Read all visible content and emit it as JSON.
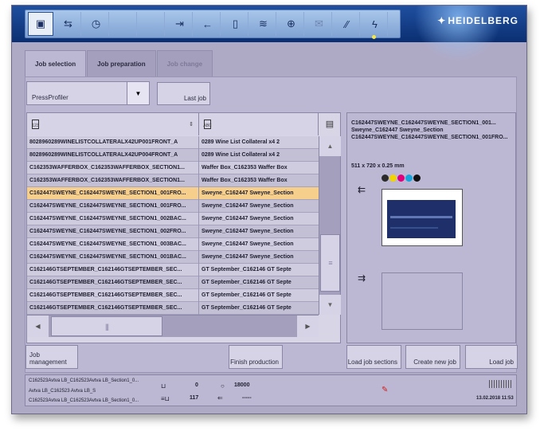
{
  "brand": "HEIDELBERG",
  "toolbar": {
    "buttons": [
      {
        "icon": "job-screen-icon",
        "active": true
      },
      {
        "icon": "transfer-icon"
      },
      {
        "icon": "clock-doc-icon"
      },
      {
        "icon": "blank-icon"
      },
      {
        "icon": "blank-icon"
      },
      {
        "icon": "feeder-icon"
      },
      {
        "icon": "arrow-left-icon"
      },
      {
        "icon": "plate-icon"
      },
      {
        "icon": "ink-fountain-icon"
      },
      {
        "icon": "register-icon"
      },
      {
        "icon": "mail-icon",
        "dim": true
      },
      {
        "icon": "pressure-icon"
      },
      {
        "icon": "lightning-icon"
      }
    ],
    "indicator_color": "#f4e64b"
  },
  "tabs": [
    {
      "label": "Job selection",
      "active": true
    },
    {
      "label": "Job preparation"
    },
    {
      "label": "Job change",
      "disabled": true
    }
  ],
  "profiler": {
    "value": "PressProfiler"
  },
  "last_job_label": "Last job",
  "table": {
    "columns": [
      {
        "icon": "job-number-icon",
        "icon_text": "123"
      },
      {
        "icon": "job-name-icon",
        "icon_text": "ABC"
      }
    ],
    "rows": [
      {
        "job": "8028960289WINELISTCOLLATERALX42UP001FRONT_A",
        "name": "0289 Wine List Collateral x4 2"
      },
      {
        "job": "8028960289WINELISTCOLLATERALX42UP004FRONT_A",
        "name": "0289 Wine List Collateral x4 2"
      },
      {
        "job": "C162353WAFFERBOX_C162353WAFFERBOX_SECTION1...",
        "name": "Waffer Box_C162353 Waffer Box"
      },
      {
        "job": "C162353WAFFERBOX_C162353WAFFERBOX_SECTION1...",
        "name": "Waffer Box_C162353 Waffer Box"
      },
      {
        "job": "C162447SWEYNE_C162447SWEYNE_SECTION1_001FRO...",
        "name": "Sweyne_C162447 Sweyne_Section",
        "selected": true
      },
      {
        "job": "C162447SWEYNE_C162447SWEYNE_SECTION1_001FRO...",
        "name": "Sweyne_C162447 Sweyne_Section"
      },
      {
        "job": "C162447SWEYNE_C162447SWEYNE_SECTION1_002BAC...",
        "name": "Sweyne_C162447 Sweyne_Section"
      },
      {
        "job": "C162447SWEYNE_C162447SWEYNE_SECTION1_002FRO...",
        "name": "Sweyne_C162447 Sweyne_Section"
      },
      {
        "job": "C162447SWEYNE_C162447SWEYNE_SECTION1_003BAC...",
        "name": "Sweyne_C162447 Sweyne_Section"
      },
      {
        "job": "C162447SWEYNE_C162447SWEYNE_SECTION1_001BAC...",
        "name": "Sweyne_C162447 Sweyne_Section"
      },
      {
        "job": "C162146GTSEPTEMBER_C162146GTSEPTEMBER_SEC...",
        "name": "GT September_C162146 GT Septe"
      },
      {
        "job": "C162146GTSEPTEMBER_C162146GTSEPTEMBER_SEC...",
        "name": "GT September_C162146 GT Septe"
      },
      {
        "job": "C162146GTSEPTEMBER_C162146GTSEPTEMBER_SEC...",
        "name": "GT September_C162146 GT Septe"
      },
      {
        "job": "C162146GTSEPTEMBER_C162146GTSEPTEMBER_SEC...",
        "name": "GT September_C162146 GT Septe"
      }
    ]
  },
  "preview": {
    "title_line1": "C162447SWEYNE_C162447SWEYNE_SECTION1_001...",
    "title_line2": "Sweyne_C162447 Sweyne_Section",
    "title_line3": "C162447SWEYNE_C162447SWEYNE_SECTION1_001FRO...",
    "size": "511 x 720 x 0.25 mm",
    "ink_colors": [
      "#2b2b2b",
      "#f1d400",
      "#e0007a",
      "#17a3dc",
      "#111111"
    ]
  },
  "buttons": {
    "job_management": "Job management",
    "finish_production": "Finish production",
    "load_job_sections": "Load job sections",
    "create_new_job": "Create new job",
    "load_job": "Load job"
  },
  "status": {
    "line1": "C162523Avtva LB_C162523Avtva LB_Section1_0...",
    "line2": "Avtva LB_C162523 Avtva LB_S",
    "line3": "C162523Avtva LB_C162523Avtva LB_Section1_0...",
    "counter1": "0",
    "counter2": "18000",
    "counter3": "117",
    "counter4": "-----",
    "datetime": "13.02.2018   11:53"
  }
}
